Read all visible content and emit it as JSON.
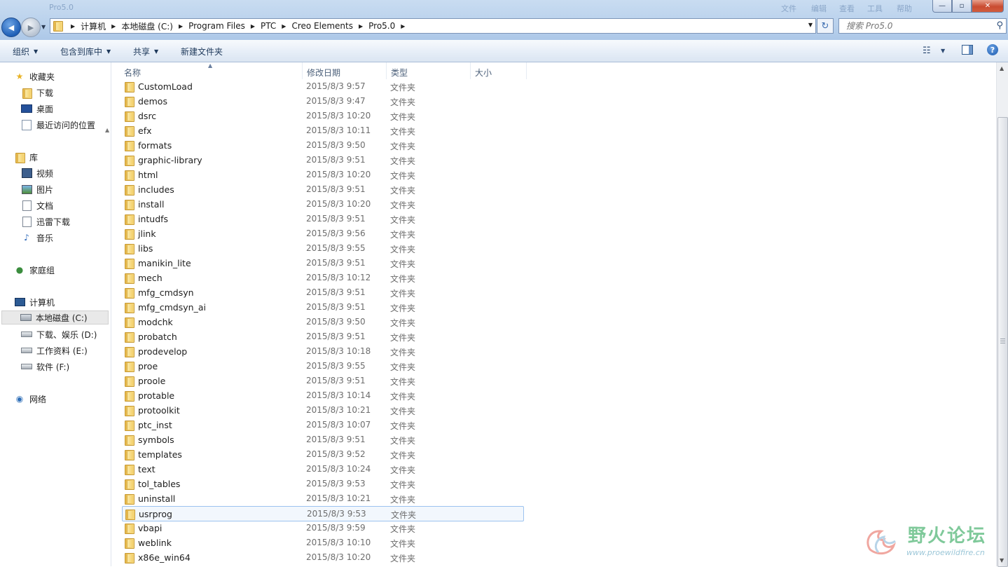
{
  "window": {
    "ghost_title": "Pro5.0",
    "ghost_menu": [
      "文件",
      "编辑",
      "查看",
      "工具",
      "帮助"
    ],
    "buttons": {
      "minimize": "—",
      "maximize": "▫",
      "close": "✕"
    }
  },
  "nav_buttons": {
    "back": "◀",
    "forward": "▶",
    "history": "▼"
  },
  "address": {
    "breadcrumbs": [
      "计算机",
      "本地磁盘 (C:)",
      "Program Files",
      "PTC",
      "Creo Elements",
      "Pro5.0"
    ],
    "separator": "▶",
    "dropdown": "▼",
    "refresh": "↻"
  },
  "search": {
    "placeholder": "搜索 Pro5.0",
    "icon": "search-icon"
  },
  "toolbar": {
    "organize": "组织",
    "include_in_library": "包含到库中",
    "share": "共享",
    "new_folder": "新建文件夹",
    "caret": "▼",
    "view_icon": "☷",
    "help": "?"
  },
  "sidebar": {
    "favorites": {
      "label": "收藏夹",
      "icon": "star-icon"
    },
    "favorite_items": [
      {
        "label": "下载",
        "icon": "download-folder-icon"
      },
      {
        "label": "桌面",
        "icon": "desktop-icon"
      },
      {
        "label": "最近访问的位置",
        "icon": "recent-places-icon"
      }
    ],
    "libraries": {
      "label": "库",
      "icon": "library-icon"
    },
    "library_items": [
      {
        "label": "视频",
        "icon": "video-icon"
      },
      {
        "label": "图片",
        "icon": "picture-icon"
      },
      {
        "label": "文档",
        "icon": "document-icon"
      },
      {
        "label": "迅雷下载",
        "icon": "thunder-download-icon"
      },
      {
        "label": "音乐",
        "icon": "music-icon"
      }
    ],
    "homegroup": {
      "label": "家庭组",
      "icon": "homegroup-icon"
    },
    "computer": {
      "label": "计算机",
      "icon": "computer-icon"
    },
    "drives": [
      {
        "label": "本地磁盘 (C:)",
        "icon": "system-drive-icon",
        "selected": true
      },
      {
        "label": "下载、娱乐 (D:)",
        "icon": "drive-icon"
      },
      {
        "label": "工作资料 (E:)",
        "icon": "drive-icon"
      },
      {
        "label": "软件 (F:)",
        "icon": "drive-icon"
      }
    ],
    "network": {
      "label": "网络",
      "icon": "network-icon"
    }
  },
  "columns": {
    "name": "名称",
    "date": "修改日期",
    "type": "类型",
    "size": "大小"
  },
  "files": [
    {
      "name": "CustomLoad",
      "date": "2015/8/3 9:57",
      "type": "文件夹"
    },
    {
      "name": "demos",
      "date": "2015/8/3 9:47",
      "type": "文件夹"
    },
    {
      "name": "dsrc",
      "date": "2015/8/3 10:20",
      "type": "文件夹"
    },
    {
      "name": "efx",
      "date": "2015/8/3 10:11",
      "type": "文件夹"
    },
    {
      "name": "formats",
      "date": "2015/8/3 9:50",
      "type": "文件夹"
    },
    {
      "name": "graphic-library",
      "date": "2015/8/3 9:51",
      "type": "文件夹"
    },
    {
      "name": "html",
      "date": "2015/8/3 10:20",
      "type": "文件夹"
    },
    {
      "name": "includes",
      "date": "2015/8/3 9:51",
      "type": "文件夹"
    },
    {
      "name": "install",
      "date": "2015/8/3 10:20",
      "type": "文件夹"
    },
    {
      "name": "intudfs",
      "date": "2015/8/3 9:51",
      "type": "文件夹"
    },
    {
      "name": "jlink",
      "date": "2015/8/3 9:56",
      "type": "文件夹"
    },
    {
      "name": "libs",
      "date": "2015/8/3 9:55",
      "type": "文件夹"
    },
    {
      "name": "manikin_lite",
      "date": "2015/8/3 9:51",
      "type": "文件夹"
    },
    {
      "name": "mech",
      "date": "2015/8/3 10:12",
      "type": "文件夹"
    },
    {
      "name": "mfg_cmdsyn",
      "date": "2015/8/3 9:51",
      "type": "文件夹"
    },
    {
      "name": "mfg_cmdsyn_ai",
      "date": "2015/8/3 9:51",
      "type": "文件夹"
    },
    {
      "name": "modchk",
      "date": "2015/8/3 9:50",
      "type": "文件夹"
    },
    {
      "name": "probatch",
      "date": "2015/8/3 9:51",
      "type": "文件夹"
    },
    {
      "name": "prodevelop",
      "date": "2015/8/3 10:18",
      "type": "文件夹"
    },
    {
      "name": "proe",
      "date": "2015/8/3 9:55",
      "type": "文件夹"
    },
    {
      "name": "proole",
      "date": "2015/8/3 9:51",
      "type": "文件夹"
    },
    {
      "name": "protable",
      "date": "2015/8/3 10:14",
      "type": "文件夹"
    },
    {
      "name": "protoolkit",
      "date": "2015/8/3 10:21",
      "type": "文件夹"
    },
    {
      "name": "ptc_inst",
      "date": "2015/8/3 10:07",
      "type": "文件夹"
    },
    {
      "name": "symbols",
      "date": "2015/8/3 9:51",
      "type": "文件夹"
    },
    {
      "name": "templates",
      "date": "2015/8/3 9:52",
      "type": "文件夹"
    },
    {
      "name": "text",
      "date": "2015/8/3 10:24",
      "type": "文件夹"
    },
    {
      "name": "tol_tables",
      "date": "2015/8/3 9:53",
      "type": "文件夹"
    },
    {
      "name": "uninstall",
      "date": "2015/8/3 10:21",
      "type": "文件夹"
    },
    {
      "name": "usrprog",
      "date": "2015/8/3 9:53",
      "type": "文件夹",
      "selected": true
    },
    {
      "name": "vbapi",
      "date": "2015/8/3 9:59",
      "type": "文件夹"
    },
    {
      "name": "weblink",
      "date": "2015/8/3 10:10",
      "type": "文件夹"
    },
    {
      "name": "x86e_win64",
      "date": "2015/8/3 10:20",
      "type": "文件夹"
    }
  ],
  "watermark": {
    "title": "野火论坛",
    "url": "www.proewildfire.cn"
  },
  "colors": {
    "title_gradient_top": "#c9dcf1",
    "selection_border": "#9cc3ef",
    "selection_fill": "#f2f7fd",
    "watermark_green": "#7fc99a"
  }
}
